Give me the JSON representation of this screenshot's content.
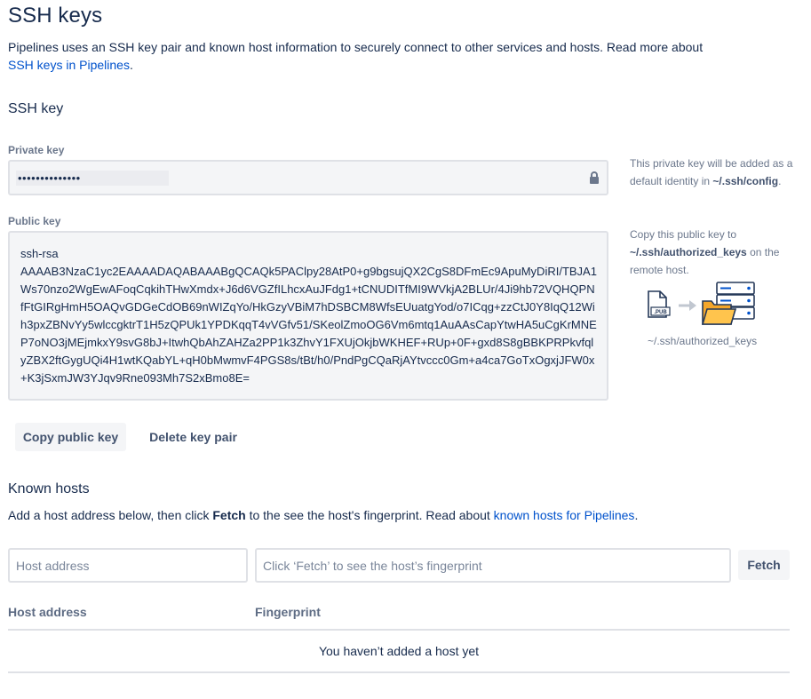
{
  "page": {
    "title": "SSH keys",
    "intro_text": "Pipelines uses an SSH key pair and known host information to securely connect to other services and hosts. Read more about ",
    "intro_link": "SSH keys in Pipelines",
    "intro_end": "."
  },
  "ssh_key": {
    "section_title": "SSH key",
    "private_label": "Private key",
    "private_value": "••••••••••••••",
    "private_note_pre": "This private key will be added as a default identity in ",
    "private_note_path": "~/.ssh/config",
    "private_note_post": ".",
    "public_label": "Public key",
    "public_value": "ssh-rsa\nAAAAB3NzaC1yc2EAAAADAQABAAABgQCAQk5PAClpy28AtP0+g9bgsujQX2CgS8DFmEc9ApuMyDiRI/TBJA1Ws70nzo2WgEwAFoqCqkihTHwXmdx+J6d6VGZfILhcxAuJFdg1+tCNUDITfMI9WVkjA2BLUr/4Ji9hb72VQHQPNfFtGIRgHmH5OAQvGDGeCdOB69nWIZqYo/HkGzyVBiM7hDSBCM8WfsEUuatgYod/o7ICqg+zzCtJ0Y8IqQ12Wih3pxZBNvYy5wlccgktrT1H5zQPUk1YPDKqqT4vVGfv51/SKeolZmoOG6Vm6mtq1AuAAsCapYtwHA5uCgKrMNEP7oNO3jMEjmkxY9svG8bJ+ItwhQbAhZAHZa2PP1k3ZhvY1FXUjOkjbWKHEF+RUp+0F+gxd8S8gBBKPRPkvfqlyZBX2ftGygUQi4H1wtKQabYL+qH0bMwmvF4PGS8s/tBt/h0/PndPgCQaRjAYtvccc0Gm+a4ca7GoTxOgxjJFW0x+K3jSxmJW3YJqv9Rne093Mh7S2xBmo8E=",
    "public_note_pre": "Copy this public key to ",
    "public_note_path": "~/.ssh/authorized_keys",
    "public_note_post": " on the remote host.",
    "diagram_file_label": ".PUB",
    "diagram_caption": "~/.ssh/authorized_keys",
    "copy_button": "Copy public key",
    "delete_button": "Delete key pair"
  },
  "known_hosts": {
    "section_title": "Known hosts",
    "help_pre": "Add a host address below, then click ",
    "help_bold": "Fetch",
    "help_mid": " to the see the host's fingerprint. Read about ",
    "help_link": "known hosts for Pipelines",
    "help_end": ".",
    "host_placeholder": "Host address",
    "fingerprint_placeholder": "Click ‘Fetch’ to see the host’s fingerprint",
    "fetch_button": "Fetch",
    "col_host": "Host address",
    "col_fingerprint": "Fingerprint",
    "empty_text": "You haven’t added a host yet"
  },
  "colors": {
    "link": "#0052cc",
    "text": "#172b4d",
    "subtle": "#6b778c",
    "field_bg": "#f4f5f7",
    "border": "#dfe1e6",
    "folder": "#f4a62a",
    "server": "#0052cc"
  },
  "icons": [
    "lock-icon",
    "pub-file-icon",
    "arrow-right-icon",
    "folder-icon",
    "server-icon"
  ]
}
